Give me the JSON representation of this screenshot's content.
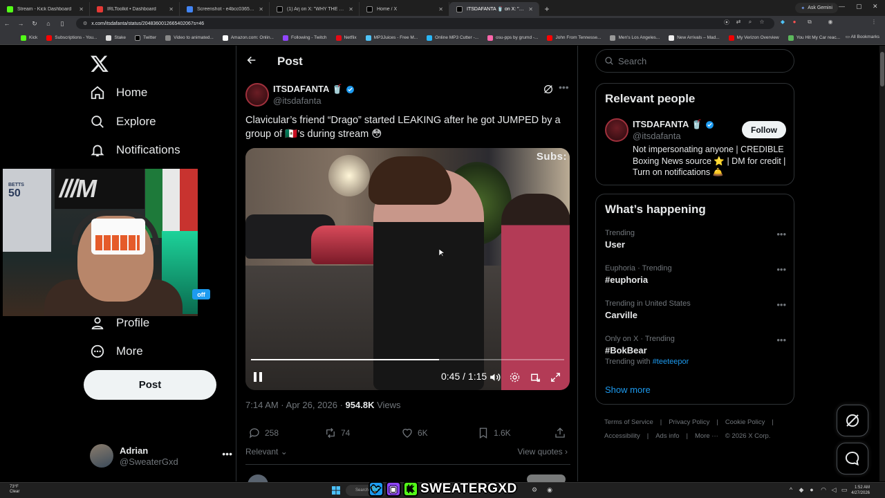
{
  "browser": {
    "tabs": [
      {
        "title": "Stream - Kick Dashboard",
        "color": "#53fc18"
      },
      {
        "title": "IRLToolkit • Dashboard",
        "color": "#e53935"
      },
      {
        "title": "Screenshot - e4bcc0365efb43...",
        "color": "#4285f4"
      },
      {
        "title": "(1) Arj on X: \"WHY THE FUCK...",
        "color": "#ffffff"
      },
      {
        "title": "Home / X",
        "color": "#ffffff"
      },
      {
        "title": "ITSDAFANTA 🥤 on X: \"Cla...",
        "color": "#ffffff"
      }
    ],
    "ask_gemini": "Ask Gemini",
    "url": "x.com/itsdafanta/status/2048360012665402067s=46",
    "bookmarks": [
      "Kick",
      "Subscriptions - You...",
      "Stake",
      "Twitter",
      "Video to animated...",
      "Amazon.com: Onlin...",
      "Following - Twitch",
      "Netflix",
      "MP3Juices - Free M...",
      "Online MP3 Cutter -...",
      "osu-pps by grumd -...",
      "John From Tennesse...",
      "Men's Los Angeles...",
      "New Arrivals – Mad...",
      "My Verizon Overview",
      "You Hit My Car reac..."
    ],
    "all_bookmarks": "All Bookmarks"
  },
  "nav": {
    "home": "Home",
    "explore": "Explore",
    "notifications": "Notifications",
    "profile": "Profile",
    "more": "More",
    "post_button": "Post",
    "account_name": "Adrian",
    "account_handle": "@SweaterGxd"
  },
  "webcam": {
    "jersey_number": "50",
    "jersey_name": "BETTS",
    "chip": "off"
  },
  "post": {
    "heading": "Post",
    "author_name": "ITSDAFANTA 🥤",
    "author_handle": "@itsdafanta",
    "text": "Clavicular’s friend “Drago” started LEAKING after he got JUMPED by a group of 🇲🇽’s during stream 😳",
    "video": {
      "overlay_text": "Subs:",
      "time": "0:45 / 1:15",
      "progress": 0.6
    },
    "timestamp": "7:14 AM · Apr 26, 2026 · ",
    "views_count": "954.8K",
    "views_label": " Views",
    "replies": "258",
    "reposts": "74",
    "likes": "6K",
    "bookmarks": "1.6K",
    "sort_label": "Relevant",
    "view_quotes": "View quotes"
  },
  "sidebar": {
    "search_placeholder": "Search",
    "relevant_title": "Relevant people",
    "person_name": "ITSDAFANTA 🥤",
    "person_handle": "@itsdafanta",
    "follow_label": "Follow",
    "person_bio": "Not impersonating anyone | CREDIBLE Boxing News source ⭐ | DM for credit | Turn on notifications 🛎️",
    "happening_title": "What’s happening",
    "trends": [
      {
        "label": "Trending",
        "name": "User",
        "with": ""
      },
      {
        "label": "Euphoria · Trending",
        "name": "#euphoria",
        "with": ""
      },
      {
        "label": "Trending in United States",
        "name": "Carville",
        "with": ""
      },
      {
        "label": "Only on X · Trending",
        "name": "#BokBear",
        "with": "#teeteepor"
      }
    ],
    "trending_with_label": "Trending with ",
    "show_more": "Show more",
    "footer": [
      "Terms of Service",
      "|",
      "Privacy Policy",
      "|",
      "Cookie Policy",
      "|",
      "Accessibility",
      "|",
      "Ads info",
      "|",
      "More ···",
      "© 2026 X Corp."
    ]
  },
  "taskbar": {
    "temp": "73°F",
    "weather": "Clear",
    "search": "Search",
    "brand": "SWEATERGXD",
    "time": "1:52 AM",
    "date": "4/27/2026"
  },
  "colors": {
    "accent": "#1d9bf0",
    "text_primary": "#e7e9ea",
    "text_secondary": "#71767b",
    "border": "#2f3336"
  }
}
